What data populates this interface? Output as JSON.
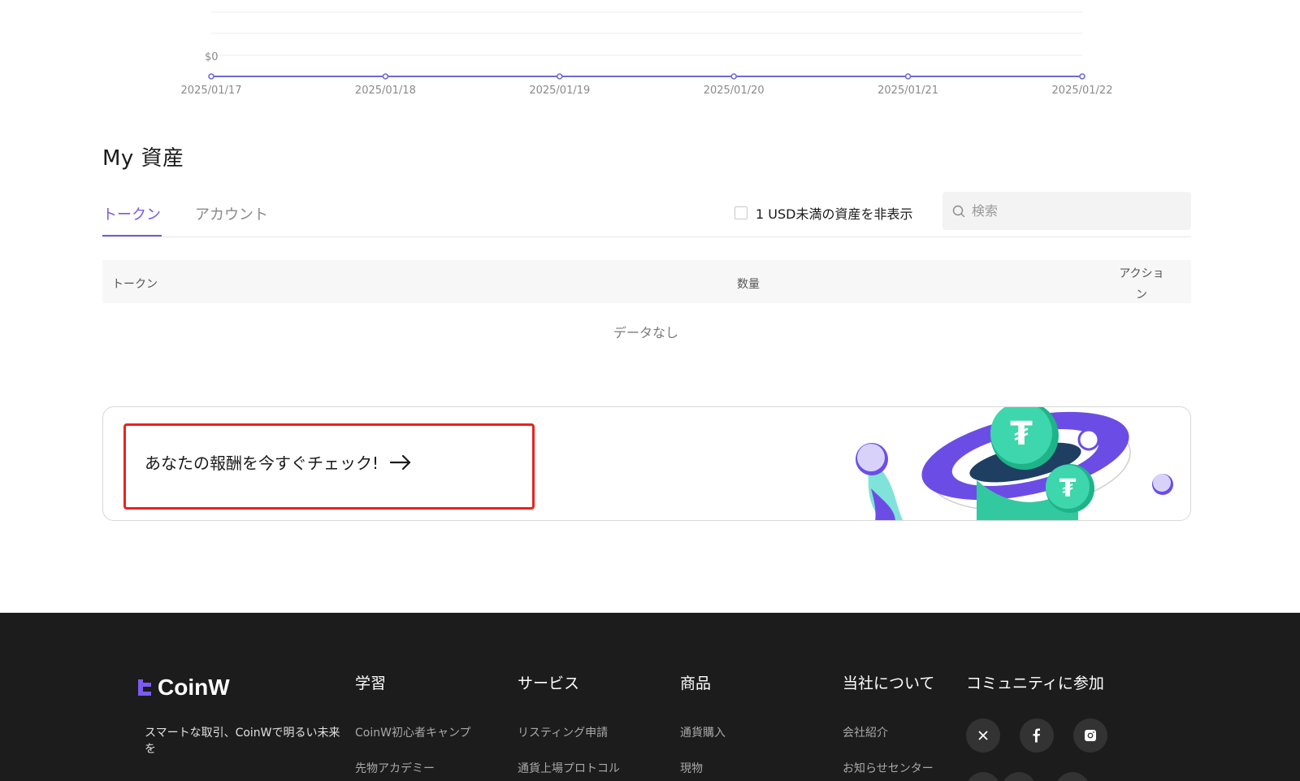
{
  "chart_data": {
    "type": "line",
    "x": [
      "2025/01/17",
      "2025/01/18",
      "2025/01/19",
      "2025/01/20",
      "2025/01/21",
      "2025/01/22"
    ],
    "series": [
      {
        "values": [
          0,
          0,
          0,
          0,
          0,
          0
        ]
      }
    ],
    "y_tick_labels": [
      "$0"
    ],
    "line_color": "#6e6ad8",
    "grid": true
  },
  "assets": {
    "title": "My 資産",
    "tabs": [
      {
        "label": "トークン"
      },
      {
        "label": "アカウント"
      }
    ],
    "hide_small_label": "1 USD未満の資産を非表示",
    "search": {
      "placeholder": "検索"
    },
    "table": {
      "columns": [
        "トークン",
        "数量",
        "アクション"
      ],
      "action_column": [
        "アクショ",
        "ン"
      ],
      "empty_text": "データなし"
    }
  },
  "banner": {
    "text": "あなたの報酬を今すぐチェック!",
    "arrow_icon": "arrow-right-icon",
    "highlight_color": "#e8241c"
  },
  "footer": {
    "brand": "CoinW",
    "tagline": "スマートな取引、CoinWで明るい未来を",
    "columns": [
      {
        "title": "学習",
        "links": [
          "CoinW初心者キャンプ",
          "先物アカデミー"
        ]
      },
      {
        "title": "サービス",
        "links": [
          "リスティング申請",
          "通貨上場プロトコル"
        ]
      },
      {
        "title": "商品",
        "links": [
          "通貨購入",
          "現物"
        ]
      },
      {
        "title": "当社について",
        "links": [
          "会社紹介",
          "お知らせセンター"
        ]
      },
      {
        "title": "コミュニティに参加",
        "links": []
      }
    ],
    "social_icons": [
      "x-icon",
      "facebook-icon",
      "instagram-icon"
    ]
  },
  "colors": {
    "accent": "#6e5ce6",
    "footer_bg": "#1c1c1c"
  }
}
